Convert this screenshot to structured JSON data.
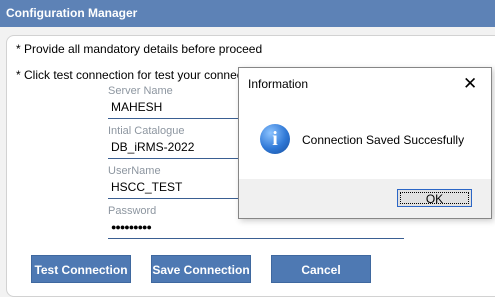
{
  "window": {
    "title": "Configuration Manager"
  },
  "notes": {
    "line1": "* Provide all mandatory details before proceed",
    "line2": "* Click test connection for test your connection"
  },
  "form": {
    "server": {
      "label": "Server Name",
      "value": "MAHESH"
    },
    "catalogue": {
      "label": "Intial Catalogue",
      "value": "DB_iRMS-2022"
    },
    "username": {
      "label": "UserName",
      "value": "HSCC_TEST"
    },
    "password": {
      "label": "Password",
      "value": "●●●●●●●●●"
    }
  },
  "buttons": {
    "test": "Test Connection",
    "save": "Save Connection",
    "cancel": "Cancel"
  },
  "dialog": {
    "title": "Information",
    "close_glyph": "✕",
    "icon_glyph": "i",
    "message": "Connection Saved Succesfully",
    "ok": "OK"
  },
  "colors": {
    "titlebar": "#5d82b6",
    "button": "#4e79b3",
    "field_line": "#3a5f92"
  }
}
